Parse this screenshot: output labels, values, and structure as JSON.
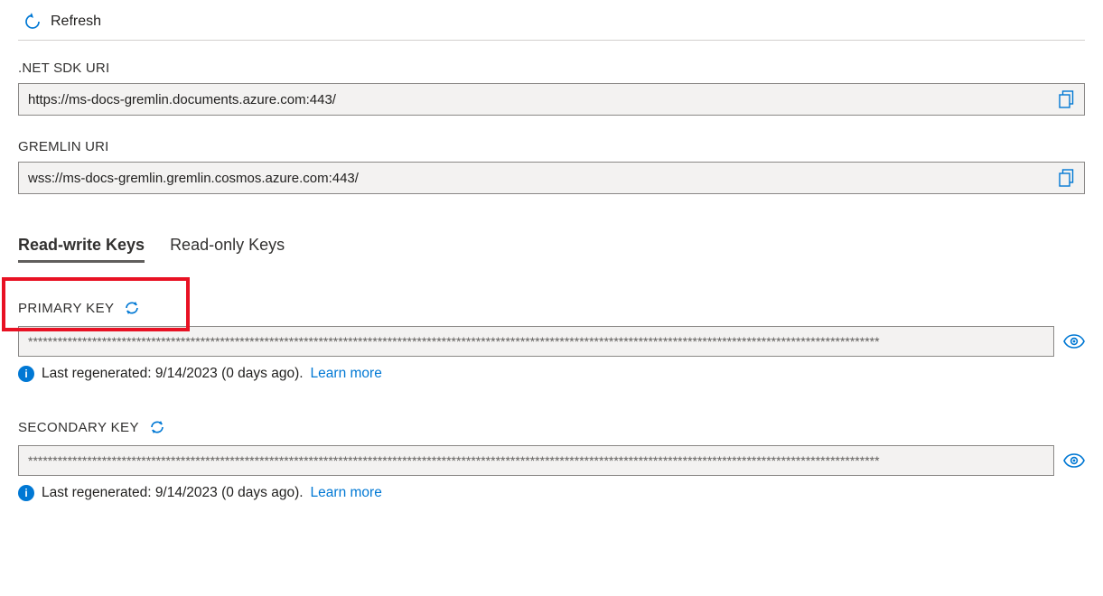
{
  "toolbar": {
    "refresh_label": "Refresh"
  },
  "fields": {
    "sdk_uri_label": ".NET SDK URI",
    "sdk_uri_value": "https://ms-docs-gremlin.documents.azure.com:443/",
    "gremlin_uri_label": "GREMLIN URI",
    "gremlin_uri_value": "wss://ms-docs-gremlin.gremlin.cosmos.azure.com:443/"
  },
  "tabs": {
    "readwrite": "Read-write Keys",
    "readonly": "Read-only Keys"
  },
  "keys": {
    "primary_label": "PRIMARY KEY",
    "primary_value": "*****************************************************************************************************************************************************************************",
    "secondary_label": "SECONDARY KEY",
    "secondary_value": "*****************************************************************************************************************************************************************************",
    "regenerated_prefix": "Last regenerated: ",
    "regenerated_date": "9/14/2023 (0 days ago).",
    "learn_more": "Learn more"
  }
}
